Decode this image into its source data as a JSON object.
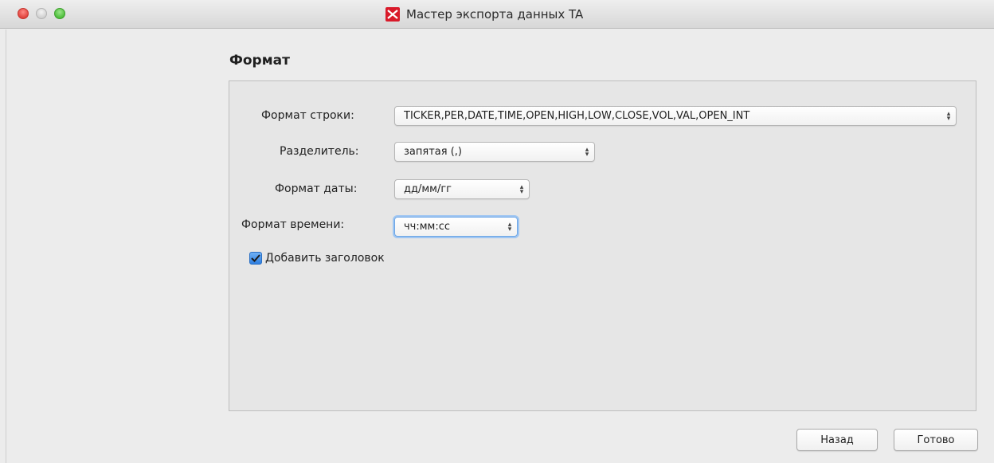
{
  "window": {
    "title": "Мастер экспорта данных TA",
    "app_icon": "moex-logo-icon",
    "accent": "#d91a2a"
  },
  "section": {
    "title": "Формат"
  },
  "form": {
    "row_format": {
      "label": "Формат строки:",
      "value": "TICKER,PER,DATE,TIME,OPEN,HIGH,LOW,CLOSE,VOL,VAL,OPEN_INT"
    },
    "separator": {
      "label": "Разделитель:",
      "value": "запятая (,)"
    },
    "date_format": {
      "label": "Формат даты:",
      "value": "дд/мм/гг"
    },
    "time_format": {
      "label": "Формат времени:",
      "value": "чч:мм:сс"
    },
    "add_header": {
      "label": "Добавить заголовок",
      "checked": true
    }
  },
  "buttons": {
    "back": "Назад",
    "done": "Готово"
  },
  "colors": {
    "focus_ring": "#9fc6f2",
    "checkbox": "#2f7fe0"
  }
}
